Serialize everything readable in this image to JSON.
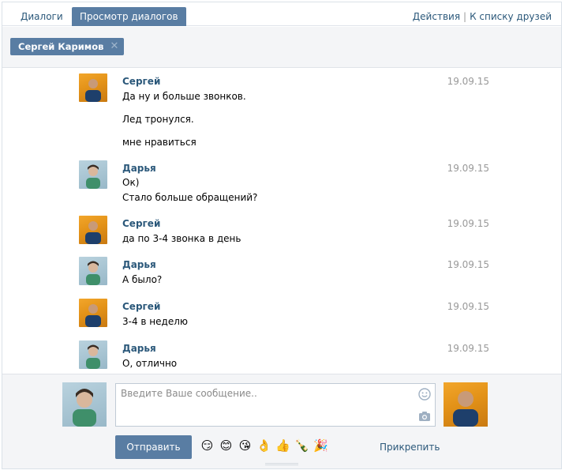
{
  "tabs": {
    "dialogs": "Диалоги",
    "view": "Просмотр диалогов"
  },
  "top_links": {
    "actions": "Действия",
    "separator": "|",
    "friends": "К списку друзей"
  },
  "recipient_chip": {
    "name": "Сергей Каримов",
    "remove_icon": "close-icon"
  },
  "messages": [
    {
      "author": "Сергей",
      "date": "19.09.15",
      "avatar": "sergey",
      "lines": [
        "Да ну и больше звонков.",
        "Лед тронулся.",
        "мне нравиться"
      ]
    },
    {
      "author": "Дарья",
      "date": "19.09.15",
      "avatar": "daria",
      "lines": [
        "Ок)",
        "Стало больше обращений?"
      ]
    },
    {
      "author": "Сергей",
      "date": "19.09.15",
      "avatar": "sergey",
      "lines": [
        "да по 3-4 звонка в день"
      ]
    },
    {
      "author": "Дарья",
      "date": "19.09.15",
      "avatar": "daria",
      "lines": [
        "А было?"
      ]
    },
    {
      "author": "Сергей",
      "date": "19.09.15",
      "avatar": "sergey",
      "lines": [
        "3-4 в неделю"
      ]
    },
    {
      "author": "Дарья",
      "date": "19.09.15",
      "avatar": "daria",
      "lines": [
        "О, отлично"
      ]
    }
  ],
  "composer": {
    "placeholder": "Введите Ваше сообщение..",
    "value": "",
    "send_label": "Отправить",
    "attach_label": "Прикрепить",
    "emojis": [
      "😏",
      "😊",
      "😘",
      "👌",
      "👍",
      "🍾",
      "🎉"
    ]
  },
  "colors": {
    "accent": "#597da3",
    "link": "#2b587a",
    "date": "#999999",
    "panel": "#f4f5f7"
  }
}
